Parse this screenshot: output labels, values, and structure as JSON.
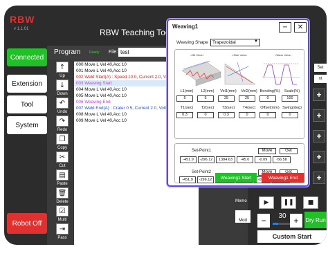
{
  "app": {
    "logo": "RBW",
    "version": "v 1.1.01",
    "title": "RBW Teaching Tool("
  },
  "sidebar": {
    "items": [
      {
        "label": "Connected",
        "color": "#22c028"
      },
      {
        "label": "Extension"
      },
      {
        "label": "Tool"
      },
      {
        "label": "System"
      }
    ],
    "robot_off": "Robot Off"
  },
  "program": {
    "title": "Program",
    "mode": "Ready",
    "file_label": "File:",
    "file_name": "test",
    "tools": [
      "Up",
      "Down",
      "Undo",
      "Redo",
      "Copy",
      "Cut",
      "Paste",
      "Delete",
      "Multi",
      "Pass"
    ],
    "lines": [
      {
        "text": "000 Move L Vel 40,Acc 10",
        "color": "#111111"
      },
      {
        "text": "001 Move L Vel 40,Acc 10",
        "color": "#111111"
      },
      {
        "text": "002 Weld Start(A) : Speed 10.0, Current 2.0, Volt 0.1",
        "color": "#e02020"
      },
      {
        "text": "003 Weaving Start",
        "color": "#c040e0"
      },
      {
        "text": "004 Move L Vel 40,Acc 10",
        "color": "#111111"
      },
      {
        "text": "005 Move L Vel 40,Acc 10",
        "color": "#111111"
      },
      {
        "text": "006 Weaving End",
        "color": "#c040e0"
      },
      {
        "text": "007 Weld End(A) : Crater 0.5, Current 2.0, Volt 0.1",
        "color": "#1f4fd8"
      },
      {
        "text": "008 Move L Vel 40,Acc 10",
        "color": "#111111"
      },
      {
        "text": "009 Move L Vel 40,Acc 10",
        "color": "#111111"
      }
    ],
    "selected_index": 3
  },
  "right_panel": {
    "memo": "Memo",
    "mod": "Mod",
    "set_label": "Set",
    "side_label": "nt",
    "speed_value": "30",
    "speed_fraction": 0.3,
    "dry_run": "Dry Run",
    "custom_start": "Custom Start"
  },
  "weaving": {
    "title": "Weaving1",
    "shape_label": "Weaving Shape :",
    "shape_value": "Trapezoidal",
    "view_labels": [
      "<3D View>",
      "<Side View>",
      "<Wave View>"
    ],
    "params_row1": {
      "headers": [
        "L1(mm)",
        "L2(mm)",
        "Vel1(mm)",
        "Vel2(mm)",
        "Bending(%)",
        "Scale(%)"
      ],
      "values": [
        "5",
        "5",
        "25",
        "25",
        "0",
        "100"
      ]
    },
    "params_row2": {
      "headers": [
        "T1(sec)",
        "T2(sec)",
        "T3(sec)",
        "T4(sec)",
        "Offset(mm)",
        "Swing(deg)"
      ],
      "values": [
        "0.3",
        "0",
        "0.3",
        "0",
        "0",
        "0"
      ]
    },
    "set_point1": {
      "label": "Set-Point1",
      "move": "Move",
      "get": "Get",
      "values": [
        "-451.9",
        "-296.12",
        "1384.63",
        "-45.0",
        "-0.09",
        "-56.58"
      ]
    },
    "set_point2": {
      "label": "Set-Point2",
      "move": "Move",
      "get": "Get",
      "values": [
        "-451.9",
        "-296.12",
        "1384.63",
        "-45.0",
        "-0.09",
        "-56.58"
      ]
    },
    "start_button": "Weaving1 Start",
    "end_button": "Weaving1 End"
  }
}
